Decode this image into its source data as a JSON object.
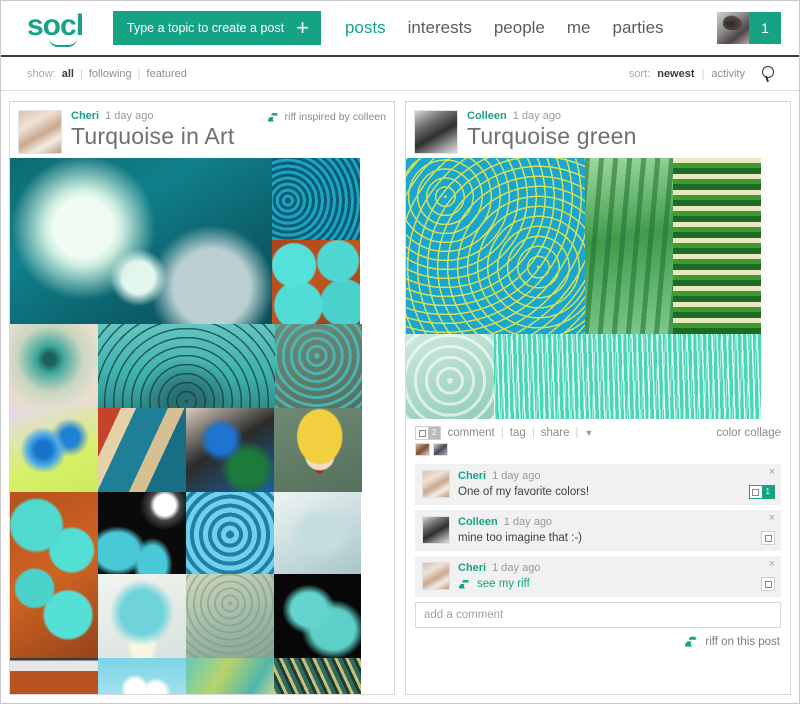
{
  "brand": {
    "logo_text": "socl",
    "accent": "#15a384",
    "link_teal": "#63c9b3"
  },
  "header": {
    "create_post_label": "Type a topic to create a post",
    "create_post_plus": "+",
    "nav": [
      {
        "label": "posts",
        "active": true
      },
      {
        "label": "interests",
        "active": false
      },
      {
        "label": "people",
        "active": false
      },
      {
        "label": "me",
        "active": false
      },
      {
        "label": "parties",
        "active": false
      }
    ],
    "user_badge_count": "1"
  },
  "filterbar": {
    "show_label": "show:",
    "show_options": [
      {
        "label": "all",
        "selected": true
      },
      {
        "label": "following",
        "selected": false
      },
      {
        "label": "featured",
        "selected": false
      }
    ],
    "sort_label": "sort:",
    "sort_options": [
      {
        "label": "newest",
        "selected": true
      },
      {
        "label": "activity",
        "selected": false
      }
    ],
    "separator": "|",
    "search_icon": "search-icon"
  },
  "posts": [
    {
      "author": "Cheri",
      "timestamp": "1 day ago",
      "title": "Turquoise in Art",
      "riff_tag": "riff inspired by colleen",
      "riff_icon": "riff-icon"
    },
    {
      "author": "Colleen",
      "timestamp": "1 day ago",
      "title": "Turquoise green",
      "actions": {
        "count_badge": "2",
        "comment_label": "comment",
        "tag_label": "tag",
        "share_label": "share",
        "separator": "|",
        "more_caret": "▼",
        "collage_link": "color collage"
      },
      "comments": [
        {
          "author": "Cheri",
          "timestamp": "1 day ago",
          "text": "One of my favorite colors!",
          "badge": "1",
          "badge_green": true,
          "close": "×",
          "is_riff": false
        },
        {
          "author": "Colleen",
          "timestamp": "1 day ago",
          "text": "mine too imagine that :-)",
          "badge": "",
          "badge_green": false,
          "close": "×",
          "is_riff": false
        },
        {
          "author": "Cheri",
          "timestamp": "1 day ago",
          "text": "see my riff",
          "badge": "",
          "badge_green": false,
          "close": "×",
          "is_riff": true
        }
      ],
      "add_comment_placeholder": "add a comment",
      "footer_action": "riff on this post",
      "footer_icon": "riff-icon"
    }
  ]
}
